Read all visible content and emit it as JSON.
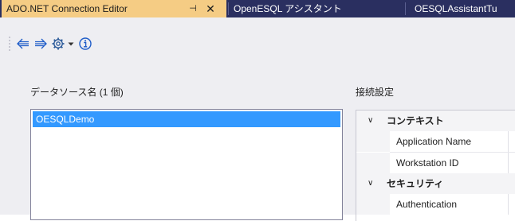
{
  "tabs": [
    {
      "label": "ADO.NET Connection Editor",
      "pin": "⊣",
      "close": "✕",
      "active": true
    },
    {
      "label": "OpenESQL アシスタント",
      "active": false
    },
    {
      "label": "OESQLAssistantTu",
      "active": false
    }
  ],
  "toolbar": {
    "items": [
      "back-icon",
      "forward-icon",
      "settings-icon",
      "dropdown-arrow-icon",
      "info-icon"
    ]
  },
  "data_source": {
    "label": "データソース名 (1 個)",
    "items": [
      "OESQLDemo"
    ]
  },
  "connection_settings": {
    "label": "接続設定",
    "categories": [
      {
        "name": "コンテキスト",
        "properties": [
          "Application Name",
          "Workstation ID"
        ]
      },
      {
        "name": "セキュリティ",
        "properties": [
          "Authentication"
        ]
      }
    ]
  },
  "colors": {
    "tab_active": "#f5cc84",
    "tab_bar": "#2a2f60",
    "selection": "#3399ff",
    "background": "#eeeef2"
  }
}
